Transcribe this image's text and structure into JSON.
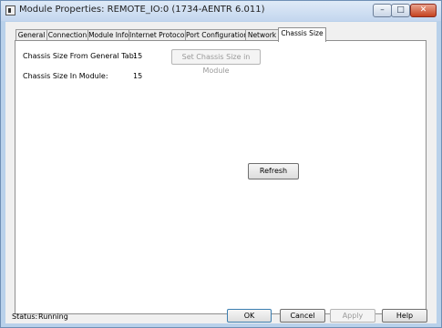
{
  "window": {
    "title": "Module Properties: REMOTE_IO:0 (1734-AENTR 6.011)",
    "controls": {
      "minimize": "–",
      "maximize": "□",
      "close": "✕"
    }
  },
  "tabs": [
    {
      "label": "General"
    },
    {
      "label": "Connection"
    },
    {
      "label": "Module Info"
    },
    {
      "label": "Internet Protocol"
    },
    {
      "label": "Port Configuration"
    },
    {
      "label": "Network"
    },
    {
      "label": "Chassis Size"
    }
  ],
  "active_tab": "Chassis Size",
  "chassis": {
    "from_general_label": "Chassis Size From General Tab:",
    "from_general_value": "15",
    "set_button": "Set Chassis Size in Module",
    "in_module_label": "Chassis Size In Module:",
    "in_module_value": "15",
    "refresh_button": "Refresh"
  },
  "footer": {
    "status_label": "Status:",
    "status_value": "Running",
    "ok": "OK",
    "cancel": "Cancel",
    "apply": "Apply",
    "help": "Help"
  },
  "colors": {
    "title_bar": "#c3d6ee",
    "close_button": "#c5421f",
    "window_frame": "#b9d1ea",
    "dialog_face": "#f0f0f0"
  },
  "icons": [
    "app-icon",
    "minimize-icon",
    "maximize-icon",
    "close-icon"
  ]
}
